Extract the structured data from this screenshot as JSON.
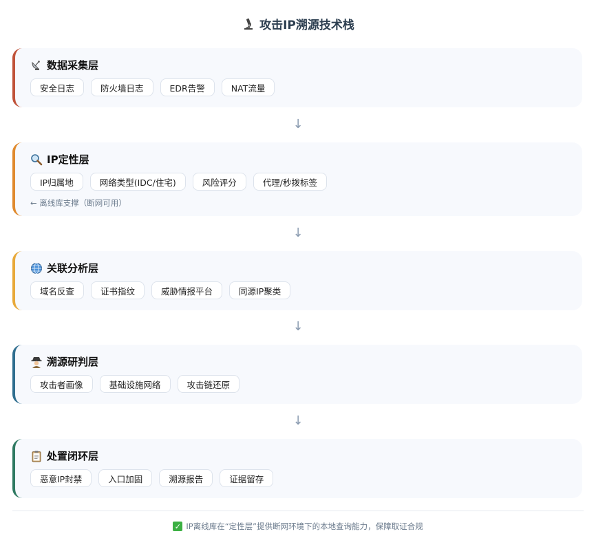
{
  "title": {
    "text": "攻击IP溯源技术栈",
    "icon": "microscope-icon"
  },
  "layers": [
    {
      "name": "数据采集层",
      "icon": "satellite-dish-icon",
      "accent": "#c0533a",
      "chips": [
        "安全日志",
        "防火墙日志",
        "EDR告警",
        "NAT流量"
      ]
    },
    {
      "name": "IP定性层",
      "icon": "magnifier-icon",
      "accent": "#e08a2e",
      "chips": [
        "IP归属地",
        "网络类型(IDC/住宅)",
        "风险评分",
        "代理/秒拨标签"
      ],
      "note": "← 离线库支撑（断网可用）"
    },
    {
      "name": "关联分析层",
      "icon": "globe-icon",
      "accent": "#e8a93a",
      "chips": [
        "域名反查",
        "证书指纹",
        "威胁情报平台",
        "同源IP聚类"
      ]
    },
    {
      "name": "溯源研判层",
      "icon": "detective-icon",
      "accent": "#2f6e8f",
      "chips": [
        "攻击者画像",
        "基础设施网络",
        "攻击链还原"
      ]
    },
    {
      "name": "处置闭环层",
      "icon": "clipboard-icon",
      "accent": "#2f7a62",
      "chips": [
        "恶意IP封禁",
        "入口加固",
        "溯源报告",
        "证据留存"
      ]
    }
  ],
  "arrow_glyph": "↓",
  "footer": {
    "text": "IP离线库在“定性层”提供断网环境下的本地查询能力，保障取证合规",
    "icon": "check-mark-icon"
  }
}
